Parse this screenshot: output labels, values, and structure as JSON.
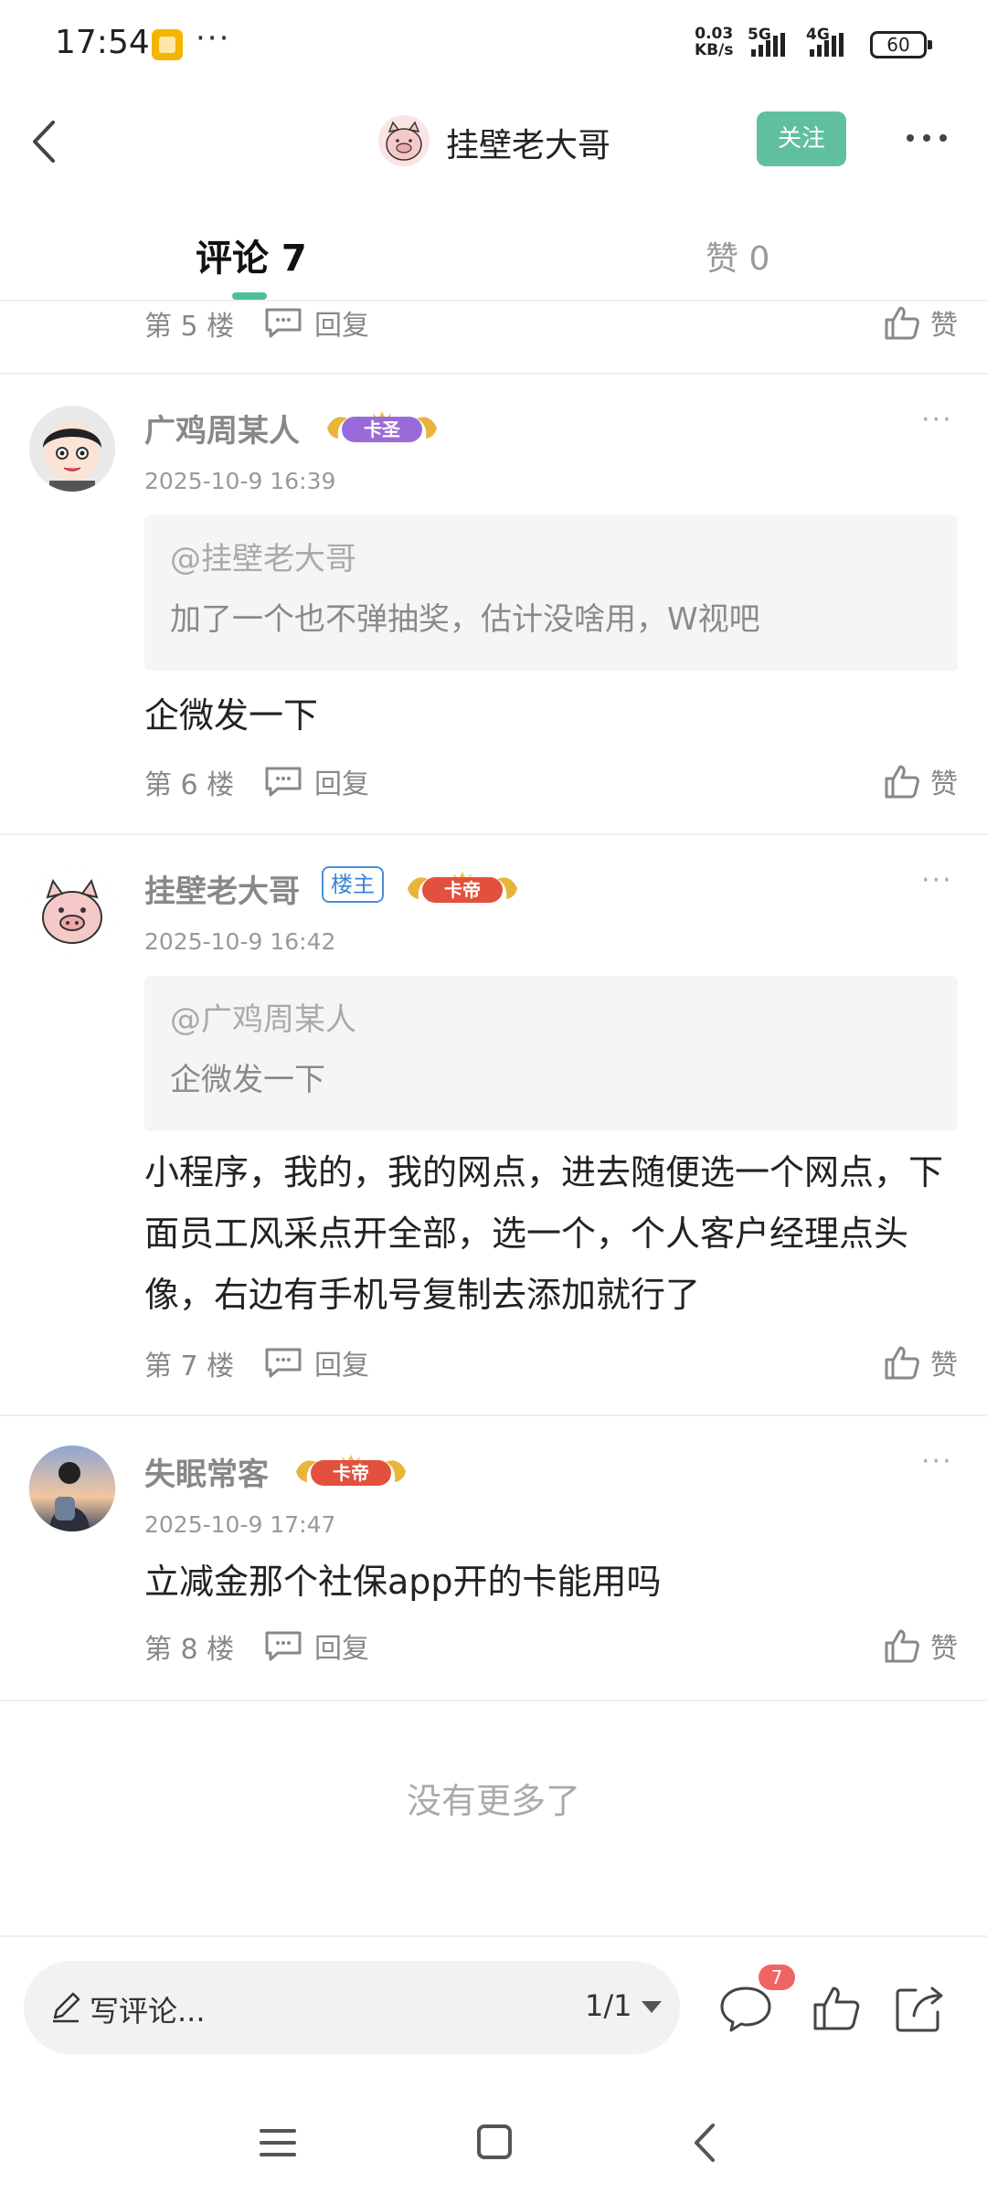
{
  "status_bar": {
    "time": "17:54",
    "more": "···",
    "speed_value": "0.03",
    "speed_unit": "KB/s",
    "net1": "5G",
    "net2": "4G",
    "battery": "60"
  },
  "header": {
    "title": "挂壁老大哥",
    "follow_label": "关注"
  },
  "tabs": {
    "comments": "评论 7",
    "likes": "赞 0"
  },
  "labels": {
    "reply": "回复",
    "like": "赞"
  },
  "top_partial": {
    "floor": "第 5 楼"
  },
  "comments": [
    {
      "user": "广鸡周某人",
      "badge": "卡圣",
      "time": "2025-10-9 16:39",
      "quote_user": "@挂壁老大哥",
      "quote_text": "加了一个也不弹抽奖，估计没啥用，W视吧",
      "text": "企微发一下",
      "floor": "第 6 楼"
    },
    {
      "user": "挂壁老大哥",
      "owner_tag": "楼主",
      "badge": "卡帝",
      "time": "2025-10-9 16:42",
      "quote_user": "@广鸡周某人",
      "quote_text": "企微发一下",
      "text": "小程序，我的，我的网点，进去随便选一个网点，下面员工风采点开全部，选一个，个人客户经理点头像，右边有手机号复制去添加就行了",
      "floor": "第 7 楼"
    },
    {
      "user": "失眠常客",
      "badge": "卡帝",
      "time": "2025-10-9 17:47",
      "text": "立减金那个社保app开的卡能用吗",
      "floor": "第 8 楼"
    }
  ],
  "no_more": "没有更多了",
  "bottom_bar": {
    "write_placeholder": "写评论...",
    "pager": "1/1",
    "comment_count": "7"
  },
  "colors": {
    "accent": "#5fbf9f",
    "badge_red": "#f06464",
    "owner_blue": "#3b85d8"
  }
}
